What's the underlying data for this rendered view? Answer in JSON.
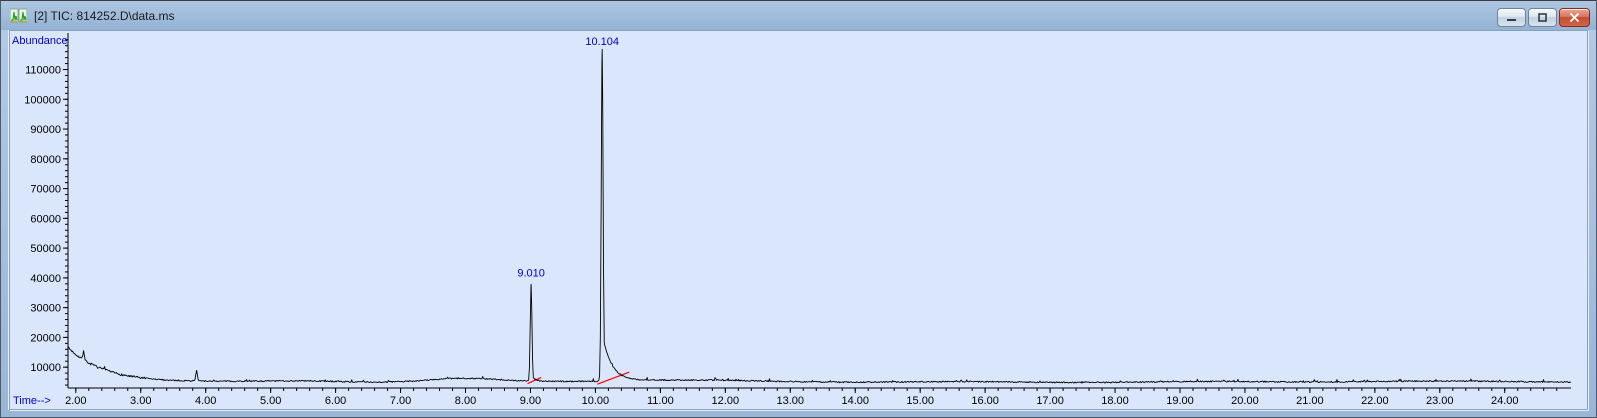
{
  "window": {
    "title": "[2] TIC: 814252.D\\data.ms",
    "controls": {
      "minimize": "minimize",
      "maximize": "maximize",
      "close": "close"
    }
  },
  "chart_data": {
    "type": "line",
    "title": "TIC: 814252.D\\data.ms",
    "xlabel": "Time-->",
    "ylabel": "Abundance",
    "x_range": [
      1.88,
      25.02
    ],
    "y_range": [
      3000,
      121600
    ],
    "x_ticks": [
      2,
      3,
      4,
      5,
      6,
      7,
      8,
      9,
      10,
      11,
      12,
      13,
      14,
      15,
      16,
      17,
      18,
      19,
      20,
      21,
      22,
      23,
      24
    ],
    "x_tick_decimals": 2,
    "x_minor_step": 0.2,
    "y_ticks": [
      10000,
      20000,
      30000,
      40000,
      50000,
      60000,
      70000,
      80000,
      90000,
      100000,
      110000
    ],
    "y_minor_step": 2000,
    "grid": false,
    "legend": false,
    "colors": {
      "plot_bg": "#d9e6fb",
      "trace": "#000000",
      "axis": "#000000",
      "tick_label": "#000000",
      "axis_title": "#0000cc",
      "peak_label": "#0000cc",
      "integration": "#ff0000"
    },
    "peaks": [
      {
        "rt": 9.01,
        "label": "9.010",
        "apex": 37500,
        "sigma": 0.013,
        "tail_amp": 2200,
        "tail_tau": 0.05,
        "label_v": 40500
      },
      {
        "rt": 10.104,
        "label": "10.104",
        "apex": 116500,
        "sigma": 0.014,
        "tail_amp": 16000,
        "tail_tau": 0.14,
        "label_v": 118200
      }
    ],
    "integration_baselines": [
      {
        "x1": 8.955,
        "y1": 4500,
        "x2": 9.165,
        "y2": 6500
      },
      {
        "x1": 10.03,
        "y1": 4300,
        "x2": 10.52,
        "y2": 8300
      }
    ],
    "trace": {
      "seed": 7,
      "dt": 0.012,
      "baseline_floor": 5100,
      "decay_amp": 11500,
      "decay_tau": 0.55,
      "noise_amp": 210,
      "noise_amp_early": 380,
      "noise_early_end": 3.1,
      "spike_chance": 0.03,
      "wander": [
        {
          "amp": 140,
          "freq": 1.7,
          "phase": 0.0
        },
        {
          "amp": 110,
          "freq": 0.53,
          "phase": 2.0
        }
      ],
      "bumps": [
        {
          "center": 2.12,
          "amp": 2500,
          "sigma": 0.012
        },
        {
          "center": 3.86,
          "amp": 3600,
          "sigma": 0.012
        },
        {
          "center": 5.6,
          "amp": 380,
          "sigma": 0.55
        },
        {
          "center": 7.95,
          "amp": 1050,
          "sigma": 0.5
        },
        {
          "center": 11.0,
          "amp": 450,
          "sigma": 0.9
        }
      ]
    }
  }
}
